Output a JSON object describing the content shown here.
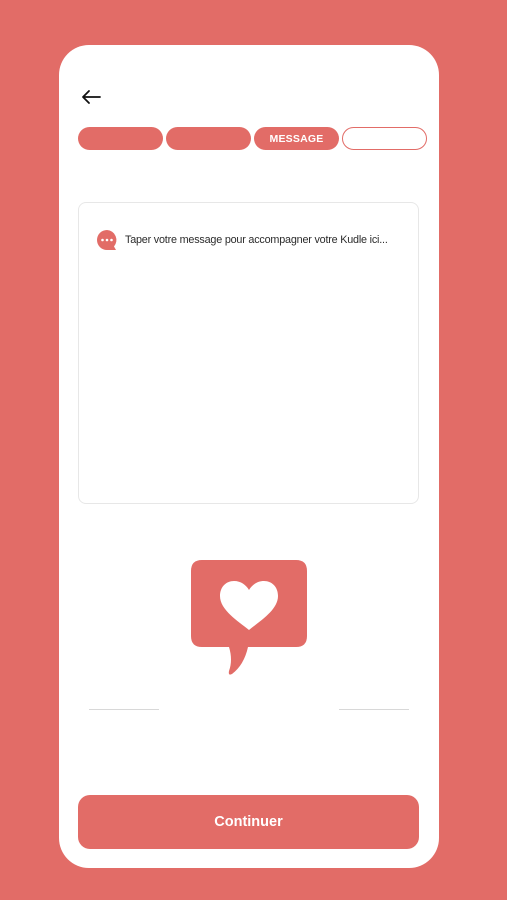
{
  "colors": {
    "accent": "#e26c67",
    "card": "#ffffff",
    "text": "#2b2b2b",
    "border": "#e7e7e7"
  },
  "header": {
    "back_icon": "arrow-left-icon"
  },
  "steps": [
    {
      "label": "",
      "state": "done"
    },
    {
      "label": "",
      "state": "done"
    },
    {
      "label": "MESSAGE",
      "state": "active"
    },
    {
      "label": "",
      "state": "pending"
    }
  ],
  "message": {
    "icon": "chat-bubble-dots-icon",
    "placeholder": "Taper votre message pour accompagner votre Kudle ici..."
  },
  "illustration": {
    "icon": "heart-speech-bubble-icon"
  },
  "footer": {
    "continue_label": "Continuer"
  }
}
